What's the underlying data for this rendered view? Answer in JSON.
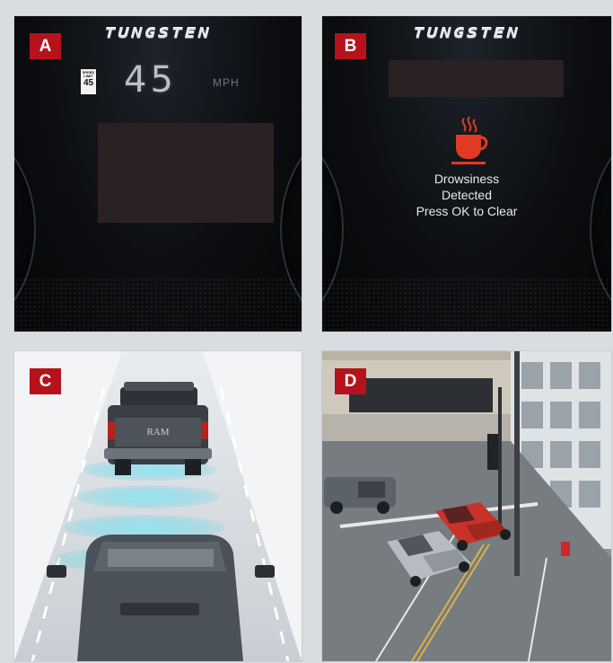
{
  "panels": {
    "a": {
      "label": "A",
      "brand": "TUNGSTEN",
      "speed_limit": {
        "top_text": "SPEED LIMIT",
        "value": "45"
      },
      "speed": "45",
      "unit": "MPH"
    },
    "b": {
      "label": "B",
      "brand": "TUNGSTEN",
      "alert_icon": "coffee-cup-icon",
      "alert_lines": [
        "Drowsiness",
        "Detected",
        "Press OK to Clear"
      ],
      "alert_icon_color": "#e23b24"
    },
    "c": {
      "label": "C",
      "tailgate_text": "RAM"
    },
    "d": {
      "label": "D"
    }
  },
  "colors": {
    "badge": "#b5121b",
    "sensor_waves": "#5fd3e6"
  }
}
